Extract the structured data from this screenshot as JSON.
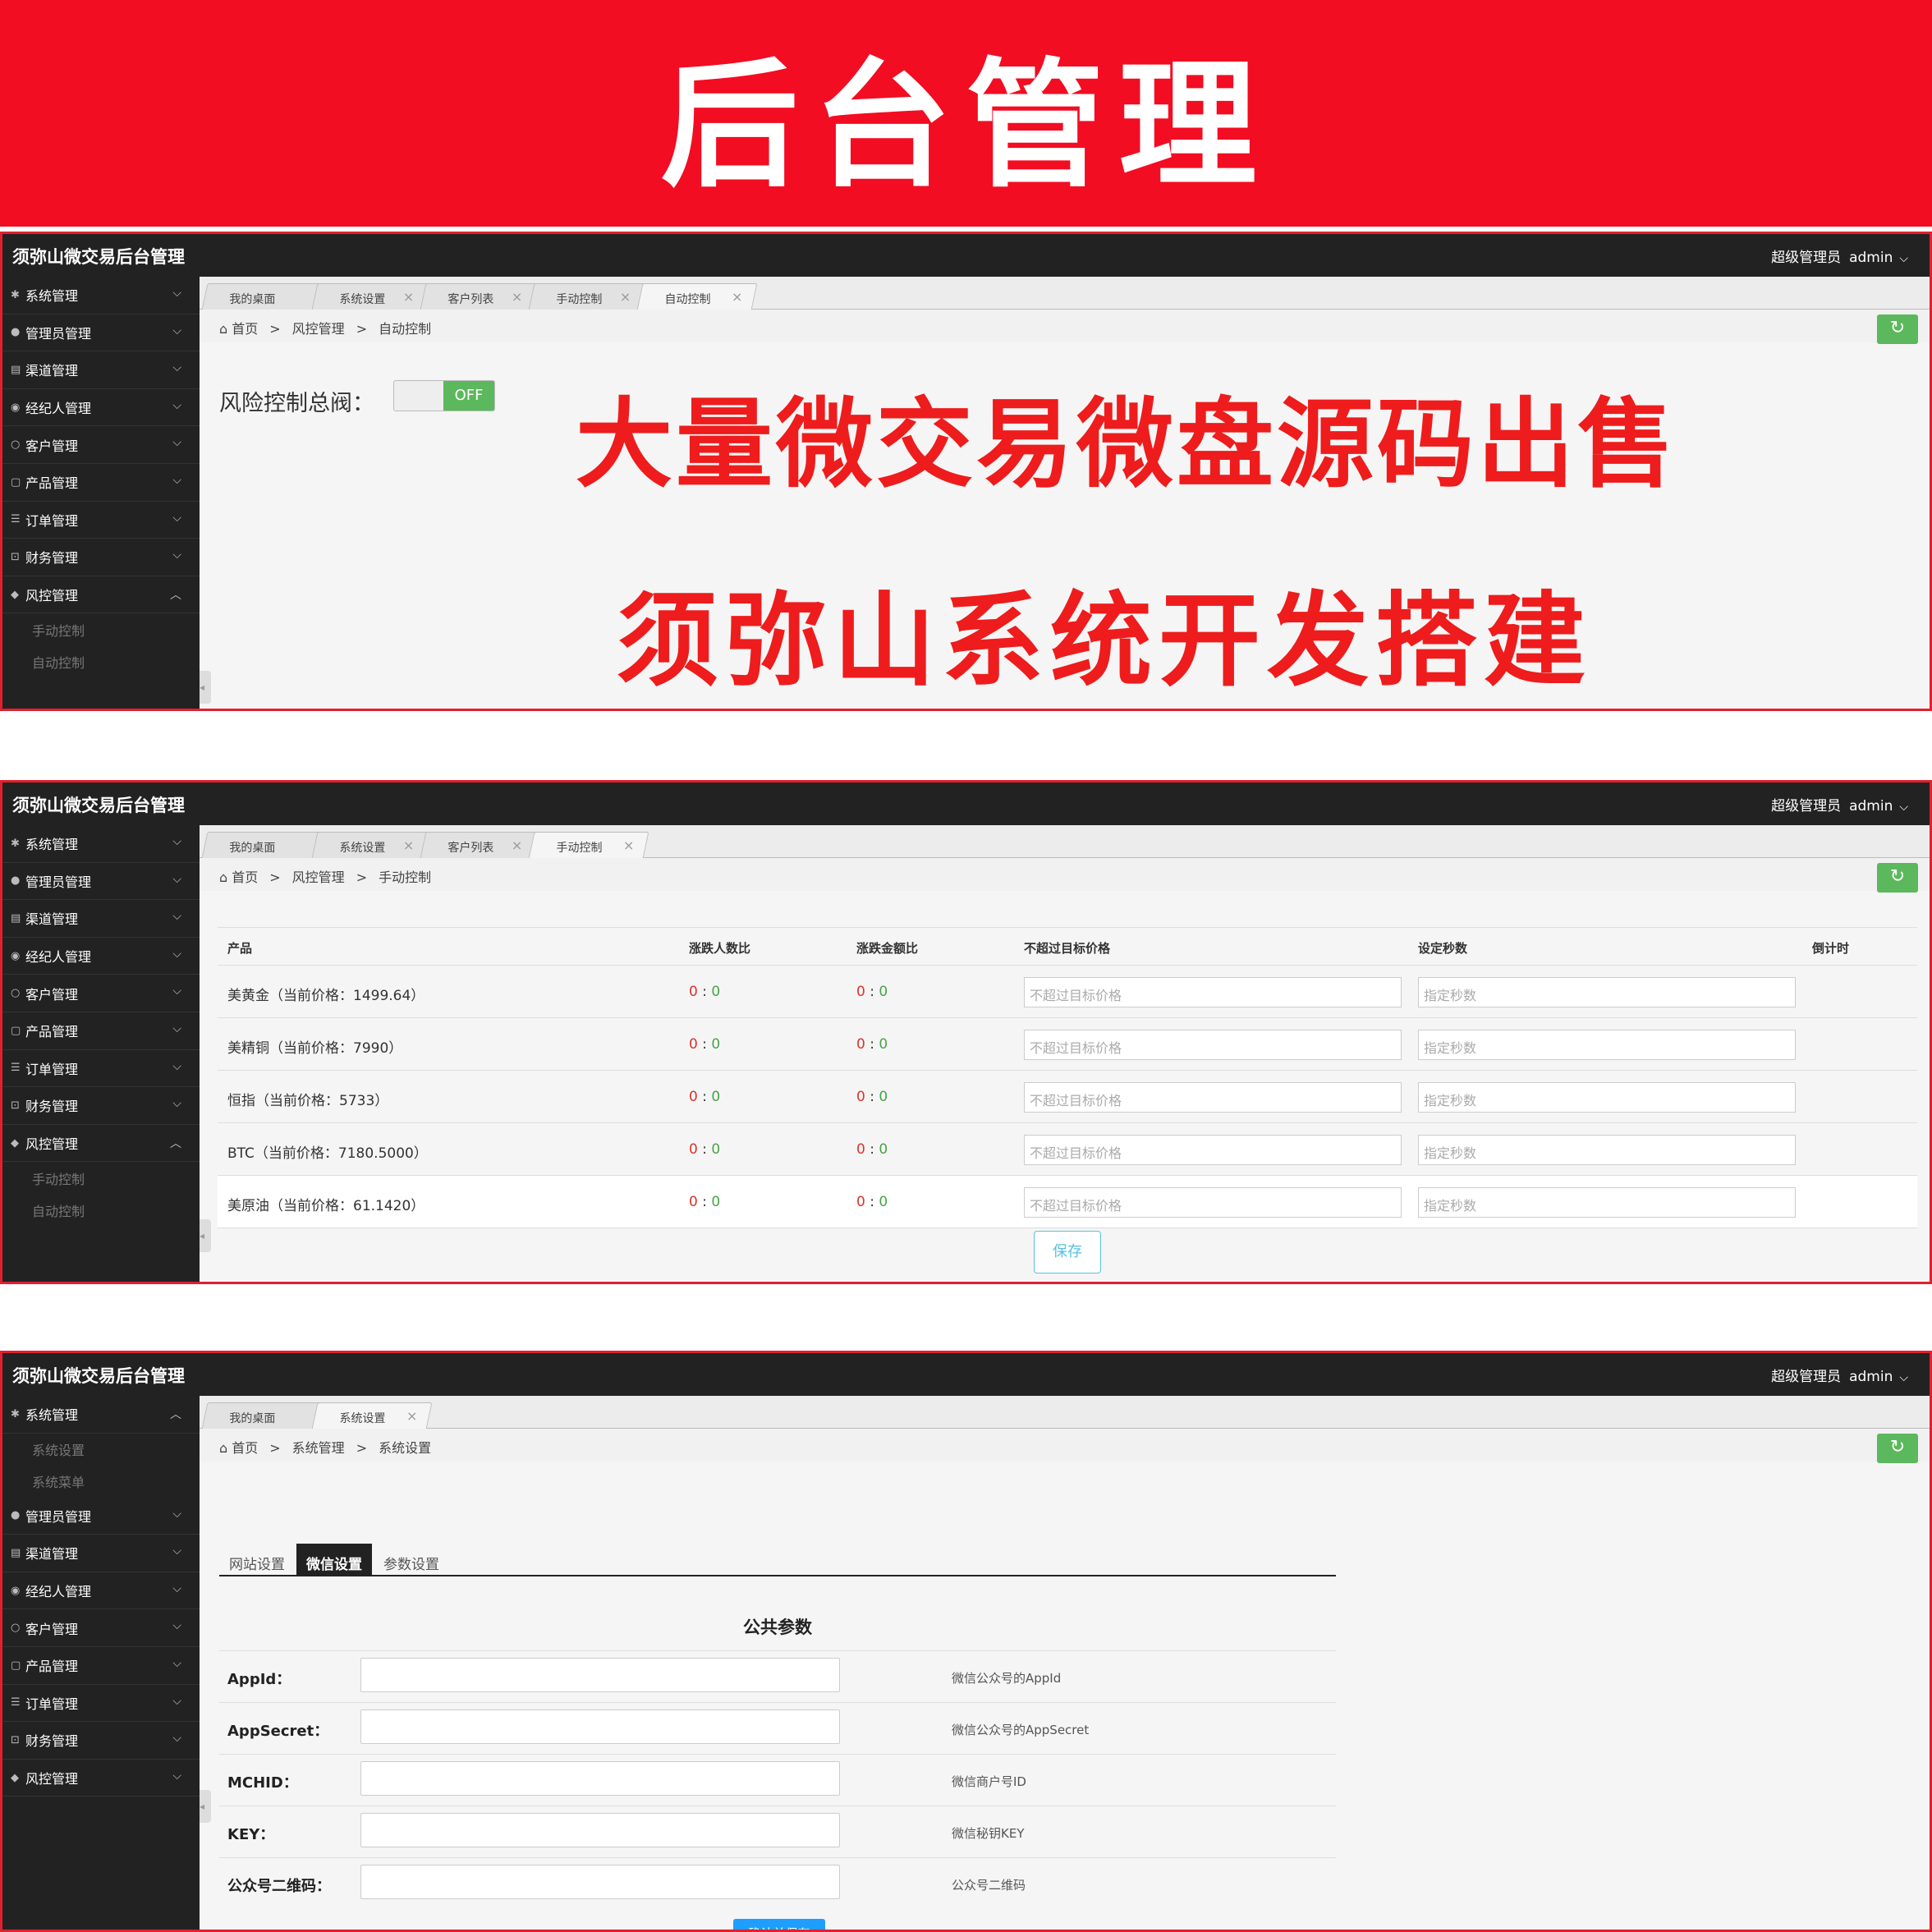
{
  "banner": {
    "title": "后台管理"
  },
  "app": {
    "title": "须弥山微交易后台管理",
    "role": "超级管理员",
    "user": "admin"
  },
  "nav": [
    "系统管理",
    "管理员管理",
    "渠道管理",
    "经纪人管理",
    "客户管理",
    "产品管理",
    "订单管理",
    "财务管理",
    "风控管理"
  ],
  "risk_sub": [
    "手动控制",
    "自动控制"
  ],
  "sys_sub": [
    "系统设置",
    "系统菜单"
  ],
  "tabs": {
    "desk": "我的桌面",
    "sys": "系统设置",
    "cust": "客户列表",
    "manual": "手动控制",
    "auto": "自动控制"
  },
  "crumb": {
    "home": "首页",
    "sep": ">",
    "risk": "风控管理",
    "sys": "系统管理",
    "manual": "手动控制",
    "auto": "自动控制",
    "sysset": "系统设置"
  },
  "p1": {
    "risk_label": "风险控制总阀：",
    "toggle": "OFF",
    "ad1": "大量微交易微盘源码出售",
    "ad2": "须弥山系统开发搭建"
  },
  "p2": {
    "headers": {
      "prod": "产品",
      "r1": "涨跌人数比",
      "r2": "涨跌金额比",
      "price": "不超过目标价格",
      "sec": "设定秒数",
      "cd": "倒计时"
    },
    "rows": [
      {
        "prod": "美黄金（当前价格：1499.64）",
        "r1a": "0",
        "r1b": "0",
        "r2a": "0",
        "r2b": "0",
        "price_ph": "不超过目标价格",
        "sec_ph": "指定秒数"
      },
      {
        "prod": "美精铜（当前价格：7990）",
        "r1a": "0",
        "r1b": "0",
        "r2a": "0",
        "r2b": "0",
        "price_ph": "不超过目标价格",
        "sec_ph": "指定秒数"
      },
      {
        "prod": "恒指（当前价格：5733）",
        "r1a": "0",
        "r1b": "0",
        "r2a": "0",
        "r2b": "0",
        "price_ph": "不超过目标价格",
        "sec_ph": "指定秒数"
      },
      {
        "prod": "BTC（当前价格：7180.5000）",
        "r1a": "0",
        "r1b": "0",
        "r2a": "0",
        "r2b": "0",
        "price_ph": "不超过目标价格",
        "sec_ph": "指定秒数"
      },
      {
        "prod": "美原油（当前价格：61.1420）",
        "r1a": "0",
        "r1b": "0",
        "r2a": "0",
        "r2b": "0",
        "price_ph": "不超过目标价格",
        "sec_ph": "指定秒数"
      }
    ],
    "colon": ":",
    "save": "保存"
  },
  "p3": {
    "tabs": [
      "网站设置",
      "微信设置",
      "参数设置"
    ],
    "form_title": "公共参数",
    "fields": [
      {
        "label": "AppId：",
        "hint": "微信公众号的AppId"
      },
      {
        "label": "AppSecret：",
        "hint": "微信公众号的AppSecret"
      },
      {
        "label": "MCHID：",
        "hint": "微信商户号ID"
      },
      {
        "label": "KEY：",
        "hint": "微信秘钥KEY"
      },
      {
        "label": "公众号二维码：",
        "hint": "公众号二维码"
      }
    ],
    "confirm": "确认并保存"
  },
  "icons": {
    "nav": [
      "gear-icon",
      "user-icon",
      "channel-icon",
      "broker-icon",
      "customer-icon",
      "product-icon",
      "order-icon",
      "lock-icon",
      "shield-icon"
    ],
    "home": "home-icon",
    "refresh": "refresh-icon",
    "close": "close-icon",
    "chevron": "chevron-down-icon"
  },
  "colors": {
    "banner": "#f20d22",
    "ad_text": "#ee1c1c",
    "topbar": "#222222",
    "refresh": "#5cb85c",
    "toggle_off": "#5cb85c",
    "confirm": "#1e9fff",
    "save_border": "#5bc0de"
  }
}
